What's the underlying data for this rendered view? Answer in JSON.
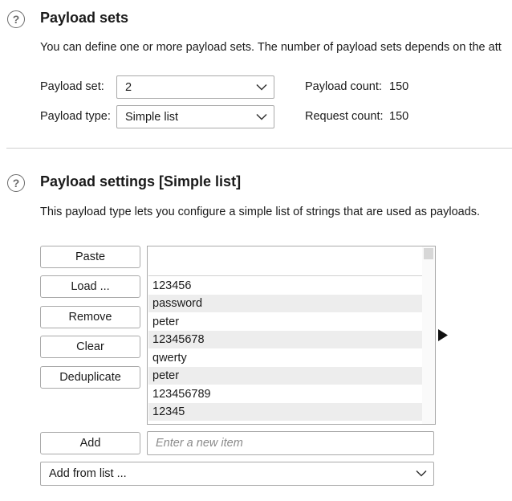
{
  "payload_sets": {
    "title": "Payload sets",
    "description": "You can define one or more payload sets. The number of payload sets depends on the att",
    "set_label": "Payload set:",
    "set_value": "2",
    "type_label": "Payload type:",
    "type_value": "Simple list",
    "payload_count_label": "Payload count:",
    "payload_count": "150",
    "request_count_label": "Request count:",
    "request_count": "150"
  },
  "payload_settings": {
    "title": "Payload settings [Simple list]",
    "description": "This payload type lets you configure a simple list of strings that are used as payloads.",
    "buttons": {
      "paste": "Paste",
      "load": "Load ...",
      "remove": "Remove",
      "clear": "Clear",
      "deduplicate": "Deduplicate",
      "add": "Add"
    },
    "list_items": [
      "123456",
      "password",
      "peter",
      "12345678",
      "qwerty",
      "peter",
      "123456789",
      "12345"
    ],
    "new_item_placeholder": "Enter a new item",
    "add_from_list": "Add from list ..."
  }
}
